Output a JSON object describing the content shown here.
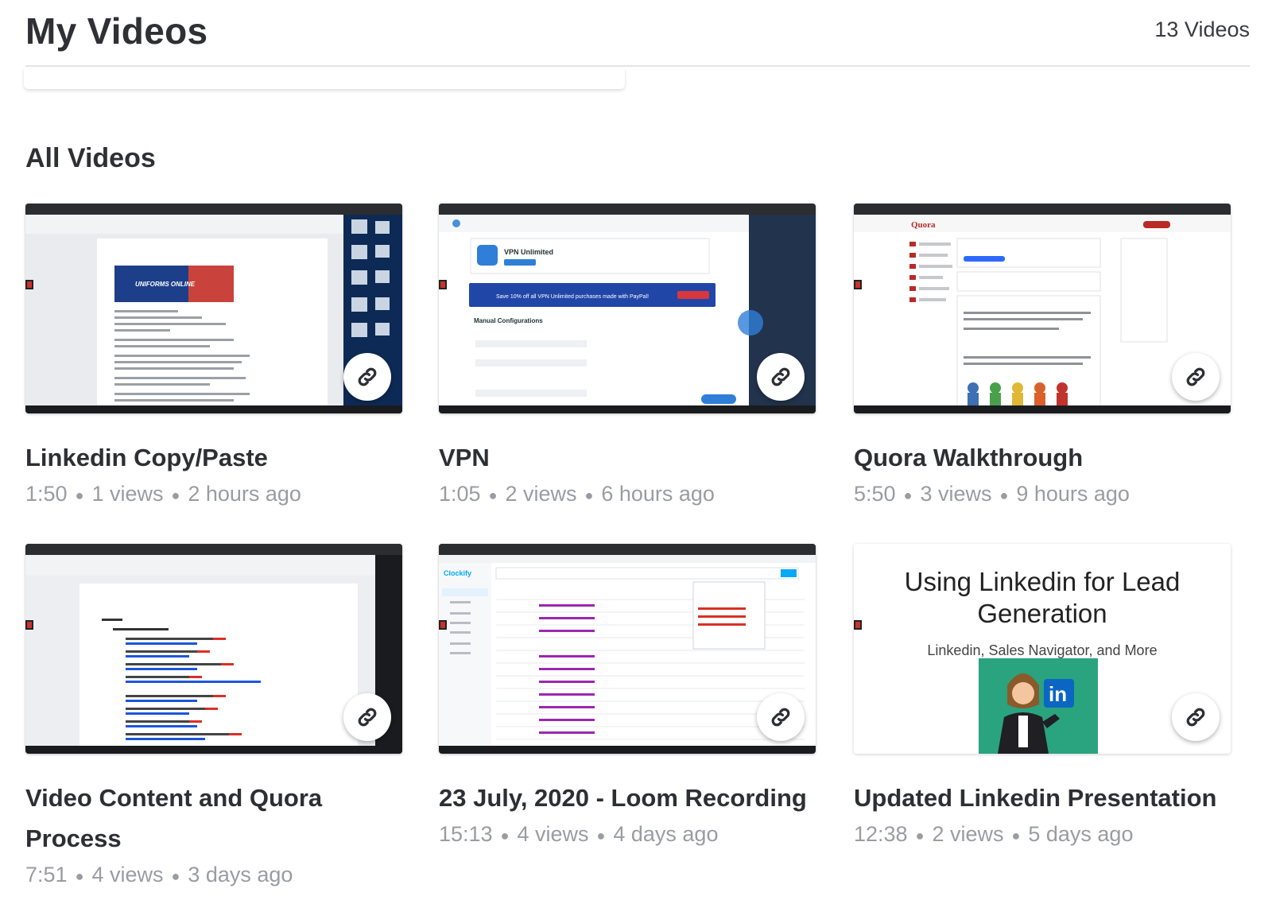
{
  "header": {
    "title": "My Videos",
    "count": "13 Videos"
  },
  "section": {
    "title": "All Videos"
  },
  "videos": [
    {
      "title": "Linkedin Copy/Paste",
      "duration": "1:50",
      "views": "1 views",
      "age": "2 hours ago"
    },
    {
      "title": "VPN",
      "duration": "1:05",
      "views": "2 views",
      "age": "6 hours ago"
    },
    {
      "title": "Quora Walkthrough",
      "duration": "5:50",
      "views": "3 views",
      "age": "9 hours ago"
    },
    {
      "title": "Video Content and Quora Process",
      "duration": "7:51",
      "views": "4 views",
      "age": "3 days ago"
    },
    {
      "title": "23 July, 2020 - Loom Recording",
      "duration": "15:13",
      "views": "4 views",
      "age": "4 days ago"
    },
    {
      "title": "Updated Linkedin Presentation",
      "duration": "12:38",
      "views": "2 views",
      "age": "5 days ago"
    }
  ],
  "presentation_thumb": {
    "title": "Using Linkedin for Lead Generation",
    "subtitle": "Linkedin, Sales Navigator, and More",
    "badge": "in"
  },
  "thumb_texts": {
    "vpn": {
      "product": "VPN Unlimited",
      "banner": "Save 10% off all VPN Unlimited purchases made with PayPal!",
      "section": "Manual Configurations"
    },
    "quora": {
      "brand": "Quora"
    },
    "clockify": {
      "brand": "Clockify"
    },
    "linkedin_doc": {
      "banner": "UNIFORMS ONLINE"
    }
  },
  "icons": {
    "share": "link-icon"
  },
  "colors": {
    "accent": "#0a66c2",
    "title": "#2d2f33",
    "meta": "#9a9ca2"
  }
}
